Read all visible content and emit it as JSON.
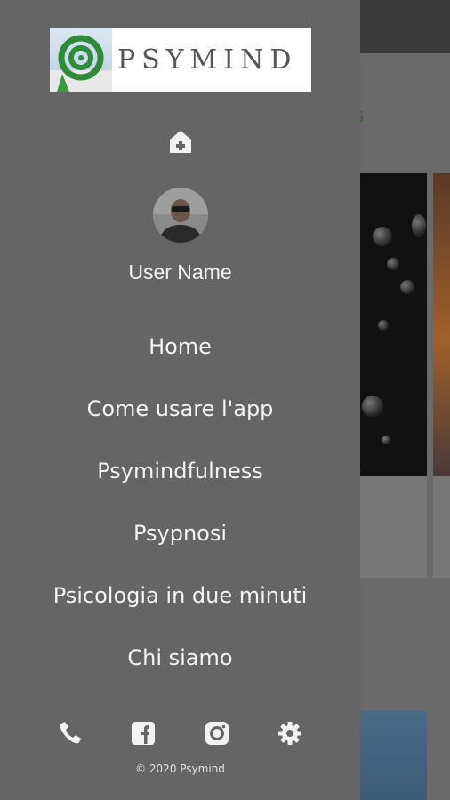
{
  "logo": {
    "text": "PSYMIND"
  },
  "user": {
    "name": "User Name"
  },
  "menu": {
    "items": [
      {
        "label": "Home"
      },
      {
        "label": "Come usare l'app"
      },
      {
        "label": "Psymindfulness"
      },
      {
        "label": "Psypnosi"
      },
      {
        "label": "Psicologia in due minuti"
      },
      {
        "label": "Chi siamo"
      }
    ]
  },
  "footer": {
    "copyright": "© 2020 Psymind"
  },
  "icons": {
    "home": "home-plus-icon",
    "phone": "phone-icon",
    "facebook": "facebook-icon",
    "instagram": "instagram-icon",
    "settings": "gear-icon"
  },
  "colors": {
    "drawer_bg": "#656565",
    "text": "#f4f4f4",
    "logo_green": "#2e8b3a"
  }
}
